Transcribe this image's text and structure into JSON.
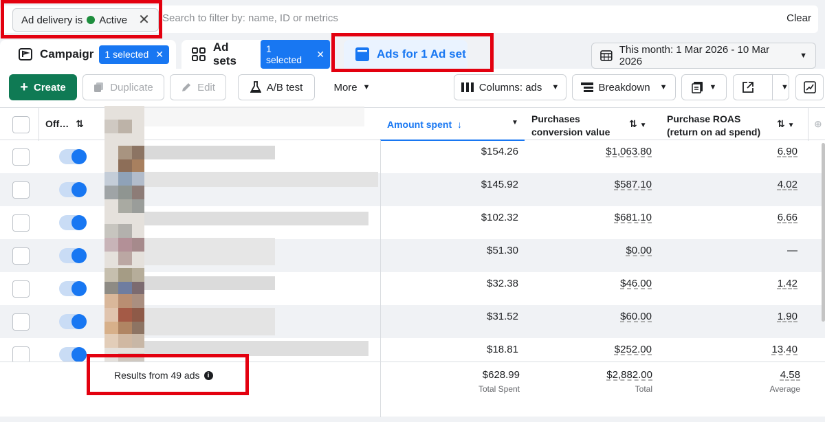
{
  "filter": {
    "chip_prefix": "Ad delivery is",
    "chip_value": "Active",
    "search_placeholder": "Search to filter by: name, ID or metrics",
    "clear_label": "Clear"
  },
  "tabs": {
    "campaigns_label": "Campaigr",
    "campaigns_badge": "1 selected",
    "adsets_label": "Ad sets",
    "adsets_badge": "1 selected",
    "ads_label": "Ads for 1 Ad set"
  },
  "date_range": "This month: 1 Mar 2026 - 10 Mar 2026",
  "toolbar": {
    "create": "Create",
    "duplicate": "Duplicate",
    "edit": "Edit",
    "ab_test": "A/B test",
    "more": "More",
    "columns": "Columns: ads",
    "breakdown": "Breakdown"
  },
  "table": {
    "headers": {
      "off_on": "Off…",
      "amount_spent": "Amount spent",
      "purchases_value_line1": "Purchases",
      "purchases_value_line2": "conversion value",
      "roas_line1": "Purchase ROAS",
      "roas_line2": "(return on ad spend)"
    },
    "rows": [
      {
        "spent": "$154.26",
        "value": "$1,063.80",
        "roas": "6.90"
      },
      {
        "spent": "$145.92",
        "value": "$587.10",
        "roas": "4.02"
      },
      {
        "spent": "$102.32",
        "value": "$681.10",
        "roas": "6.66"
      },
      {
        "spent": "$51.30",
        "value": "$0.00",
        "roas": "—"
      },
      {
        "spent": "$32.38",
        "value": "$46.00",
        "roas": "1.42"
      },
      {
        "spent": "$31.52",
        "value": "$60.00",
        "roas": "1.90"
      },
      {
        "spent": "$18.81",
        "value": "$252.00",
        "roas": "13.40"
      }
    ],
    "footer": {
      "results_label": "Results from 49 ads",
      "total_spent": "$628.99",
      "total_spent_label": "Total Spent",
      "total_value": "$2,882.00",
      "total_value_label": "Total",
      "avg_roas": "4.58",
      "avg_roas_label": "Average"
    }
  },
  "colors": {
    "accent": "#1877f2",
    "create_green": "#0f7a54",
    "highlight_red": "#e3000f",
    "active_dot": "#1e8e3e"
  }
}
